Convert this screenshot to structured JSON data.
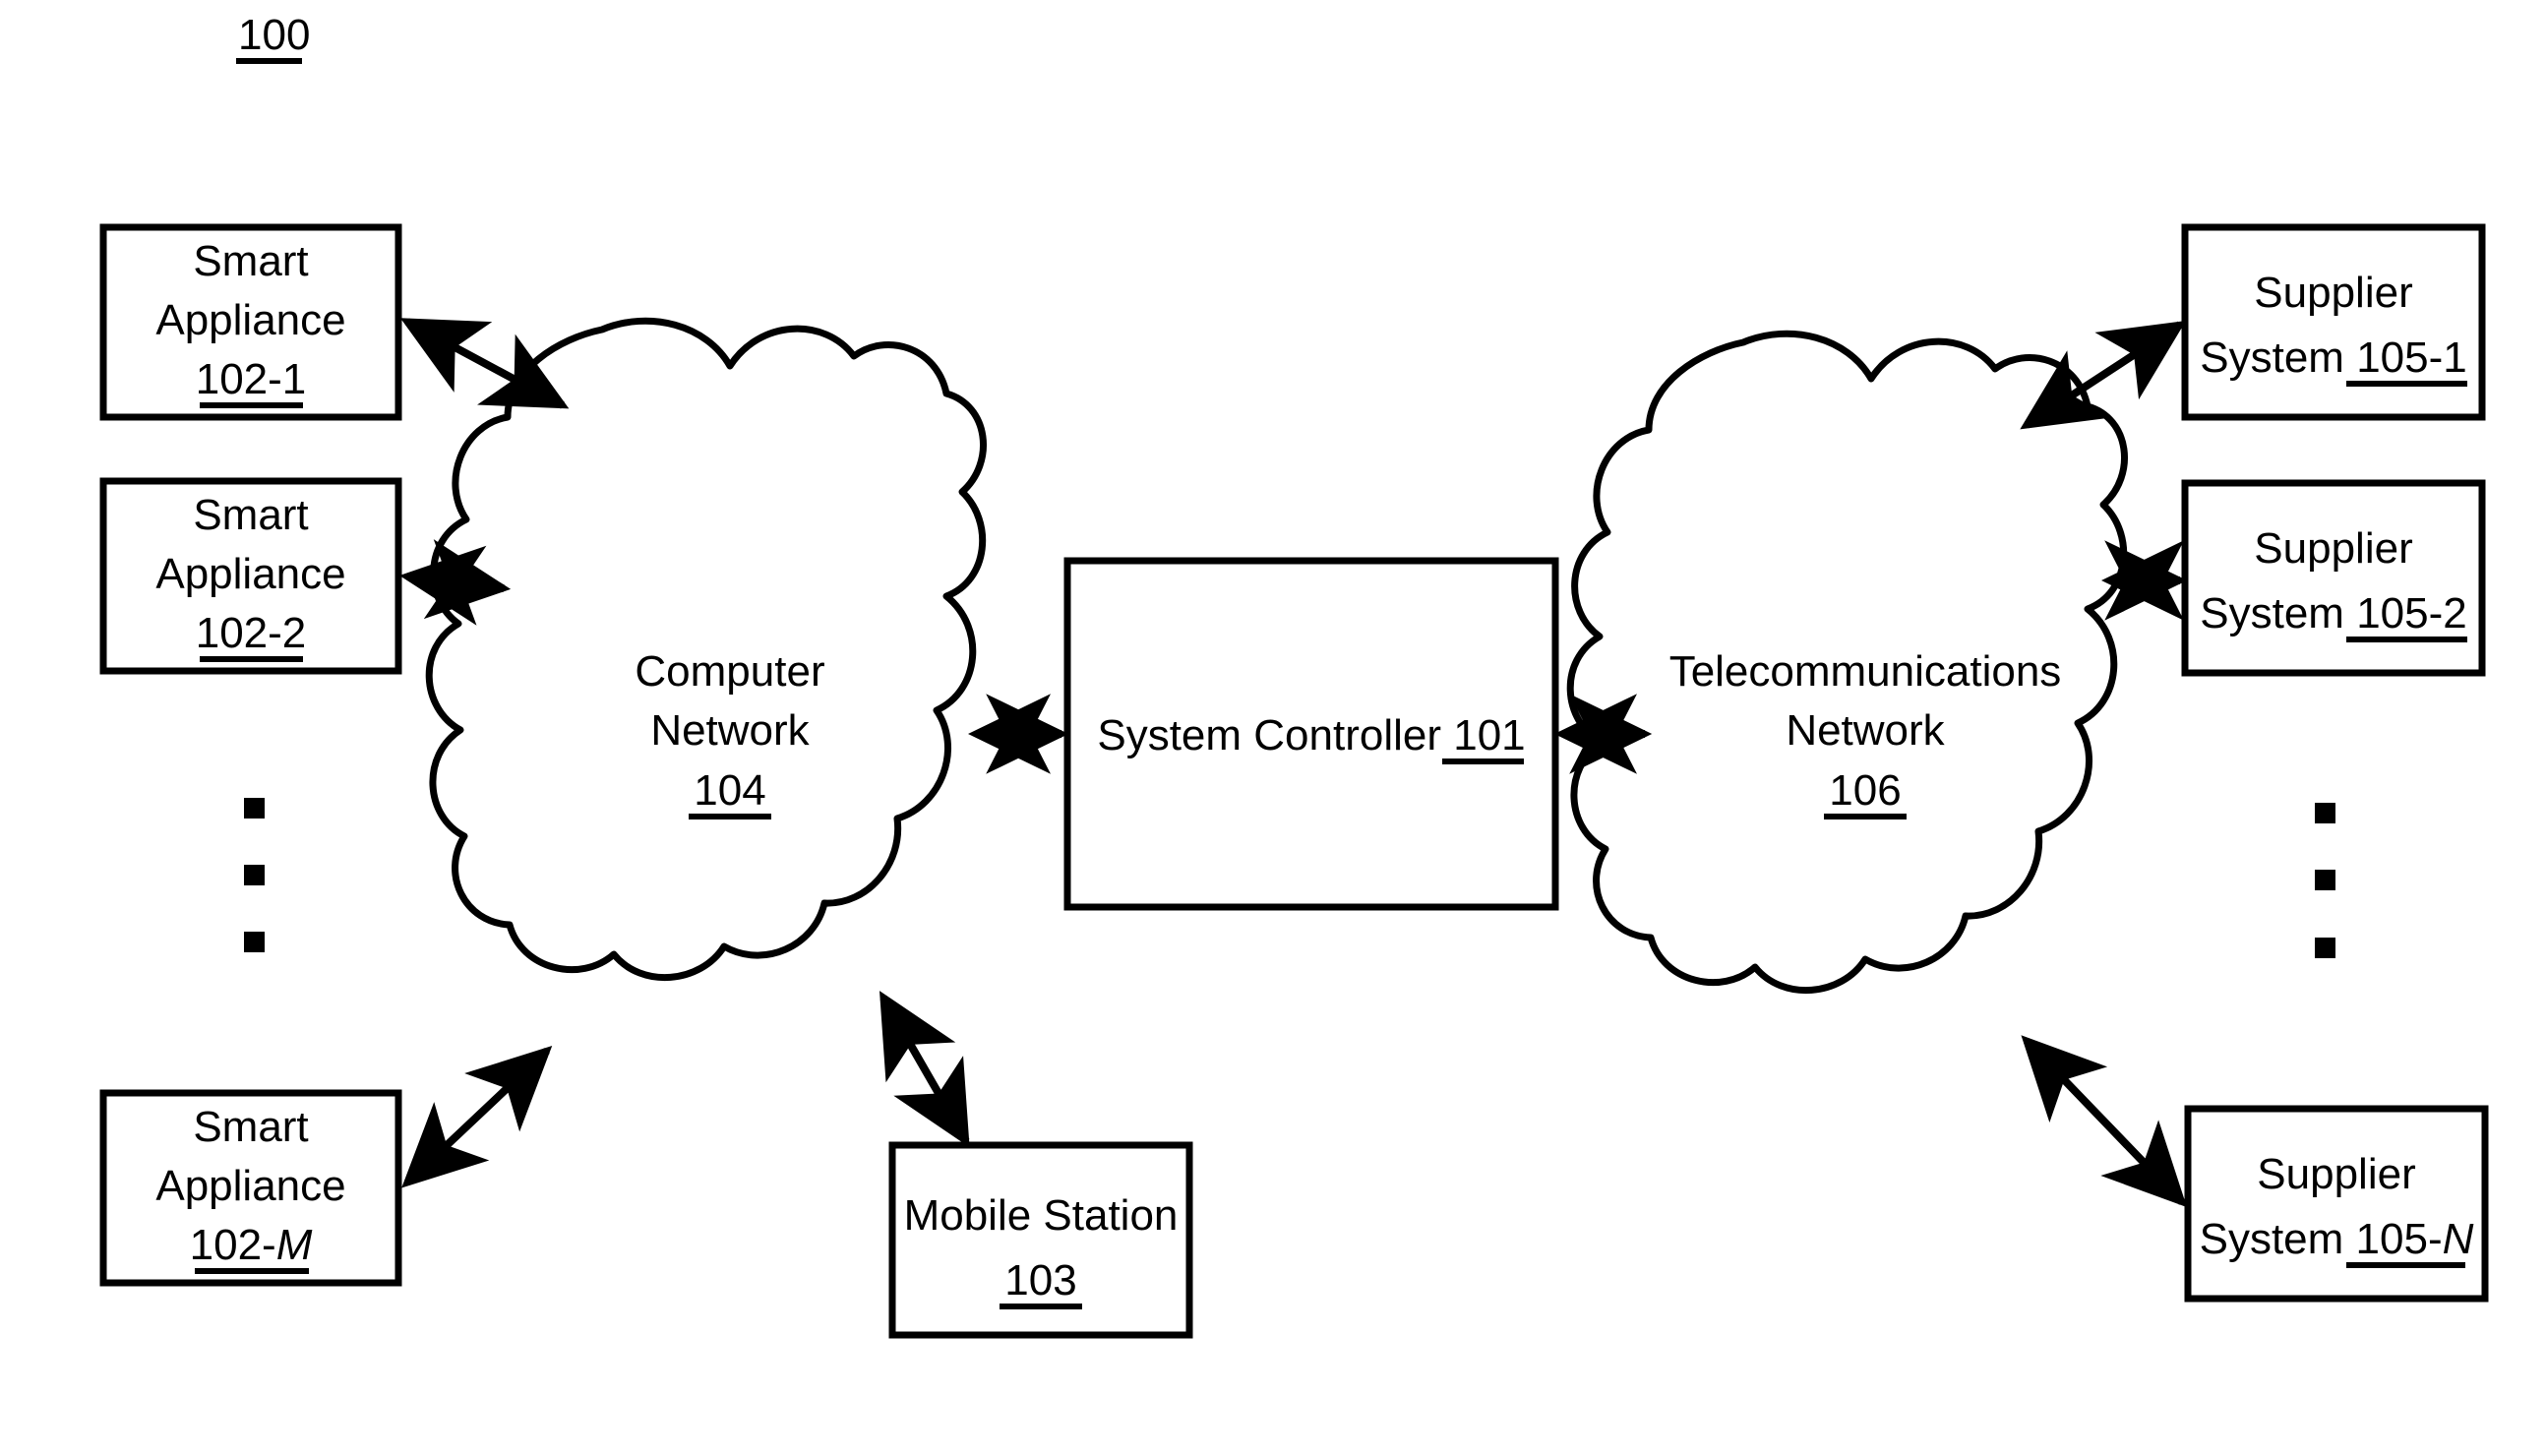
{
  "figure": {
    "number": "100",
    "type": "patent-block-diagram"
  },
  "nodes": {
    "smart_appliance_1": {
      "line1": "Smart",
      "line2": "Appliance",
      "ref": "102-1",
      "ref_italic_tail": ""
    },
    "smart_appliance_2": {
      "line1": "Smart",
      "line2": "Appliance",
      "ref": "102-2",
      "ref_italic_tail": ""
    },
    "smart_appliance_m": {
      "line1": "Smart",
      "line2": "Appliance",
      "ref": "102-",
      "ref_italic_tail": "M"
    },
    "computer_network": {
      "line1": "Computer",
      "line2": "Network",
      "ref": "104"
    },
    "system_controller": {
      "label": "System Controller ",
      "ref": "101"
    },
    "telecom_network": {
      "line1": "Telecommunications",
      "line2": "Network",
      "ref": "106"
    },
    "mobile_station": {
      "label": "Mobile Station",
      "ref": "103"
    },
    "supplier_system_1": {
      "line1": "Supplier",
      "line2": "System ",
      "ref": "105-1",
      "ref_italic_tail": ""
    },
    "supplier_system_2": {
      "line1": "Supplier",
      "line2": "System ",
      "ref": "105-2",
      "ref_italic_tail": ""
    },
    "supplier_system_n": {
      "line1": "Supplier",
      "line2": "System ",
      "ref": "105-",
      "ref_italic_tail": "N"
    }
  },
  "ellipses": {
    "left_vertical_dots": "▪ ▪ ▪",
    "right_vertical_dots": "▪ ▪ ▪"
  },
  "colors": {
    "stroke": "#000000",
    "fill": "#ffffff",
    "background": "#ffffff"
  }
}
